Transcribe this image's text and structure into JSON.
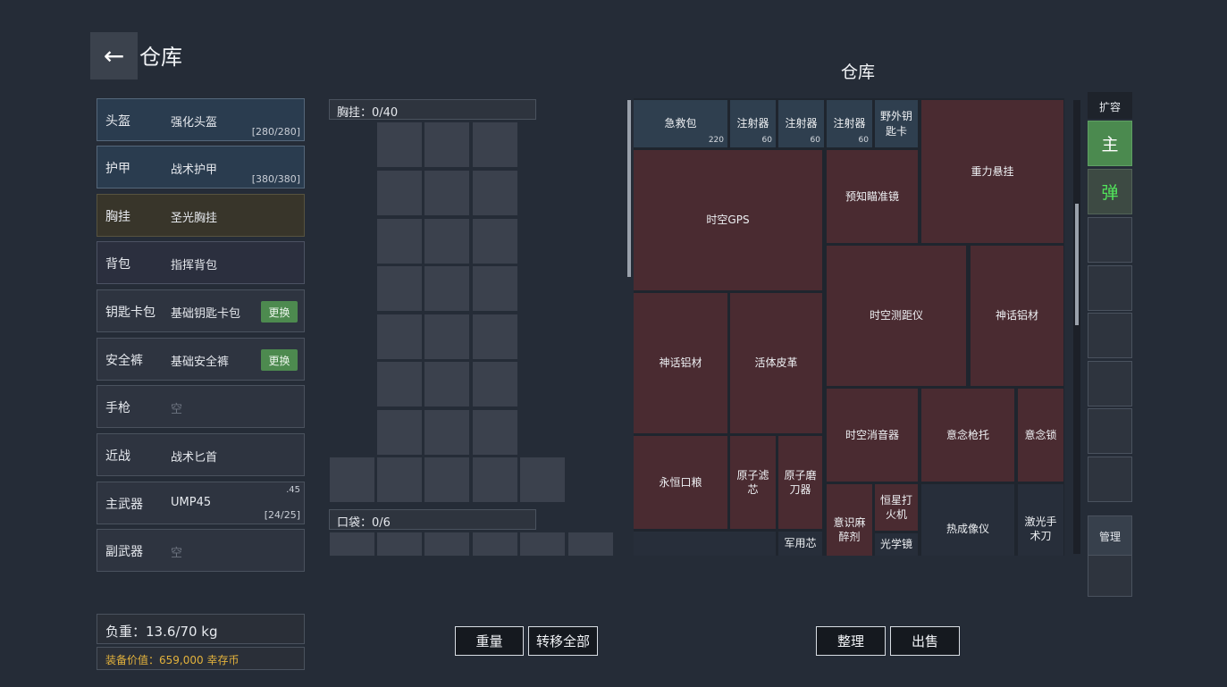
{
  "header": {
    "back_icon": "←",
    "title": "仓库"
  },
  "storage_title": "仓库",
  "equipment": [
    {
      "label": "头盔",
      "item": "强化头盔",
      "durability": "[280/280]"
    },
    {
      "label": "护甲",
      "item": "战术护甲",
      "durability": "[380/380]"
    },
    {
      "label": "胸挂",
      "item": "圣光胸挂"
    },
    {
      "label": "背包",
      "item": "指挥背包"
    },
    {
      "label": "钥匙卡包",
      "item": "基础钥匙卡包",
      "button": "更换"
    },
    {
      "label": "安全裤",
      "item": "基础安全裤",
      "button": "更换"
    },
    {
      "label": "手枪",
      "item": "空"
    },
    {
      "label": "近战",
      "item": "战术匕首"
    },
    {
      "label": "主武器",
      "item": "UMP45",
      "caliber": ".45",
      "ammo": "[24/25]"
    },
    {
      "label": "副武器",
      "item": "空"
    }
  ],
  "load": "负重：13.6/70 kg",
  "gear_value": "装备价值：659,000 幸存币",
  "chest_rig": {
    "header": "胸挂：0/40"
  },
  "pocket": {
    "header": "口袋：0/6"
  },
  "storage_items": [
    {
      "name": "急救包",
      "count": "220"
    },
    {
      "name": "注射器",
      "count": "60"
    },
    {
      "name": "注射器",
      "count": "60"
    },
    {
      "name": "注射器",
      "count": "60"
    },
    {
      "name": "野外钥匙卡"
    },
    {
      "name": "重力悬挂"
    },
    {
      "name": "时空GPS"
    },
    {
      "name": "预知瞄准镜"
    },
    {
      "name": "时空测距仪"
    },
    {
      "name": "神话铝材"
    },
    {
      "name": "神话铝材"
    },
    {
      "name": "活体皮革"
    },
    {
      "name": "时空消音器"
    },
    {
      "name": "意念枪托"
    },
    {
      "name": "意念锁"
    },
    {
      "name": "永恒口粮"
    },
    {
      "name": "原子滤芯"
    },
    {
      "name": "原子磨刀器"
    },
    {
      "name": "恒星打火机"
    },
    {
      "name": "意识麻醉剂"
    },
    {
      "name": "热成像仪"
    },
    {
      "name": "激光手术刀"
    },
    {
      "name": "军用芯"
    },
    {
      "name": "光学镜"
    }
  ],
  "side_tabs": {
    "header": "扩容",
    "main": "主",
    "ammo": "弹",
    "manage": "管理"
  },
  "buttons": {
    "weight": "重量",
    "transfer_all": "转移全部",
    "sort": "整理",
    "sell": "出售"
  },
  "colors": {
    "accent_green": "#4d8a4f",
    "value_gold": "#e3b23c",
    "item_red": "#4a2b31",
    "item_blue": "#2f3f4f"
  }
}
